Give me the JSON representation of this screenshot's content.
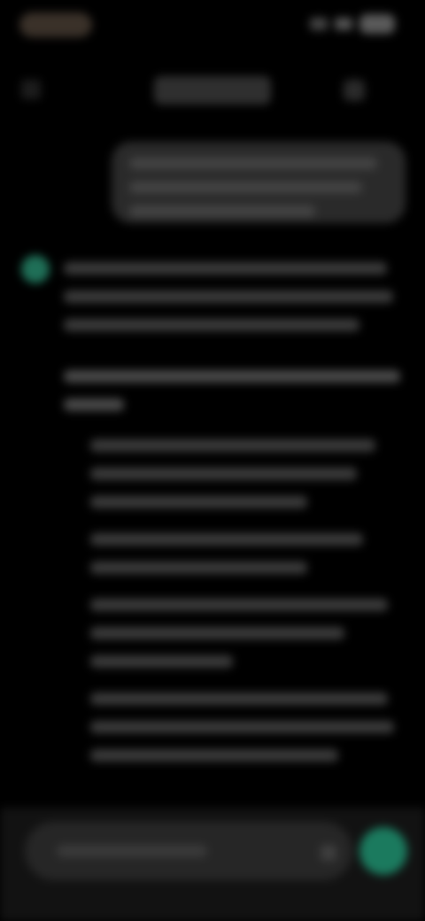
{
  "status_bar": {
    "time": "",
    "icons": [
      "signal-icon",
      "wifi-icon",
      "battery-icon"
    ]
  },
  "nav": {
    "title": "",
    "back_icon": "chevron-left-icon",
    "menu_icon": "menu-icon"
  },
  "conversation": {
    "user_message": "",
    "assistant_message": "",
    "assistant_avatar_icon": "assistant-logo-icon",
    "assistant_avatar_color": "#1f6f57"
  },
  "composer": {
    "placeholder": "",
    "mic_icon": "microphone-icon",
    "send_icon": "send-icon",
    "send_color": "#1b7a5e"
  }
}
